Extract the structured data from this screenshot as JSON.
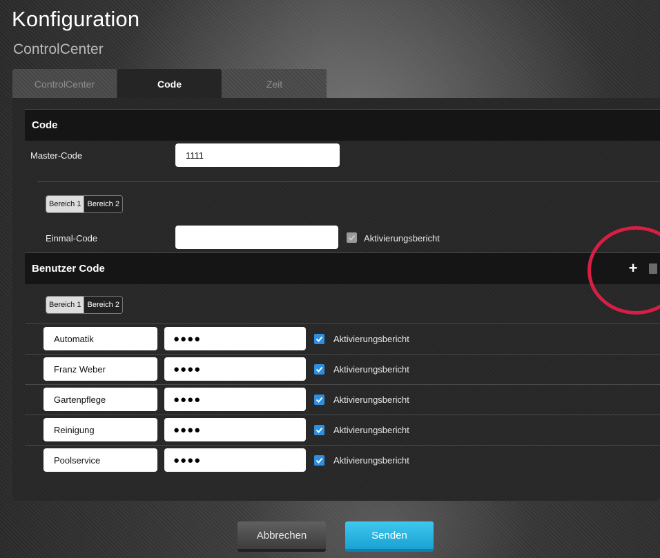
{
  "header": {
    "title": "Konfiguration",
    "subtitle": "ControlCenter"
  },
  "tabs": [
    {
      "label": "ControlCenter",
      "active": false
    },
    {
      "label": "Code",
      "active": true
    },
    {
      "label": "Zeit",
      "active": false
    }
  ],
  "code_section": {
    "heading": "Code",
    "master_code_label": "Master-Code",
    "master_code_value": "1111",
    "area_tabs": {
      "area1": "Bereich 1",
      "area2": "Bereich 2",
      "selected": "Bereich 1"
    },
    "onetime_code_label": "Einmal-Code",
    "onetime_code_value": "",
    "onetime_report_label": "Aktivierungsbericht",
    "onetime_report_checked": true,
    "onetime_report_disabled": true
  },
  "user_code_section": {
    "heading": "Benutzer Code",
    "add_icon": "plus-icon",
    "delete_icon": "trash-icon",
    "area_tabs": {
      "area1": "Bereich 1",
      "area2": "Bereich 2",
      "selected": "Bereich 1"
    },
    "users": [
      {
        "name": "Automatik",
        "code": "●●●●",
        "report_label": "Aktivierungsbericht",
        "report_checked": true
      },
      {
        "name": "Franz Weber",
        "code": "●●●●",
        "report_label": "Aktivierungsbericht",
        "report_checked": true
      },
      {
        "name": "Gartenpflege",
        "code": "●●●●",
        "report_label": "Aktivierungsbericht",
        "report_checked": true
      },
      {
        "name": "Reinigung",
        "code": "●●●●",
        "report_label": "Aktivierungsbericht",
        "report_checked": true
      },
      {
        "name": "Poolservice",
        "code": "●●●●",
        "report_label": "Aktivierungsbericht",
        "report_checked": true
      }
    ]
  },
  "footer": {
    "cancel_label": "Abbrechen",
    "send_label": "Senden"
  },
  "colors": {
    "accent": "#1aa2d4",
    "checkbox": "#2e8fe0",
    "highlight_circle": "#d81e45"
  }
}
